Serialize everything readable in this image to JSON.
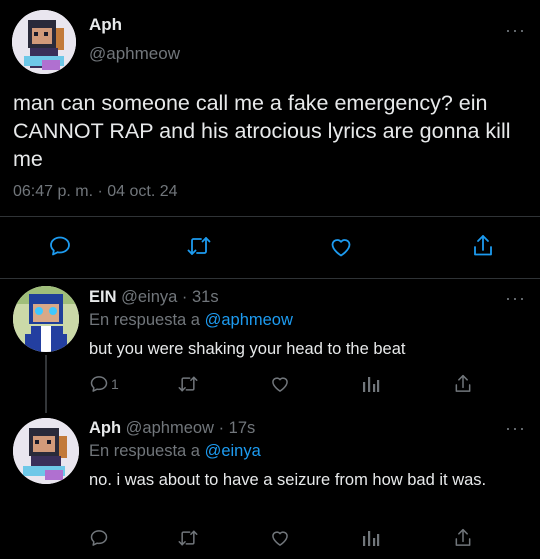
{
  "main_tweet": {
    "display_name": "Aph",
    "handle": "@aphmeow",
    "text": "man can someone call me a fake emergency? ein CANNOT RAP and his atrocious lyrics are gonna kill me",
    "timestamp": "06:47 p. m. · 04 oct. 24",
    "more": "···"
  },
  "reply1": {
    "display_name": "EIN",
    "handle": "@einya",
    "time": "· 31s",
    "reply_to_prefix": "En respuesta a",
    "reply_to_handle": "@aphmeow",
    "text": "but you were shaking your head to the beat",
    "reply_count": "1",
    "more": "···"
  },
  "reply2": {
    "display_name": "Aph",
    "handle": "@aphmeow",
    "time": "· 17s",
    "reply_to_prefix": "En respuesta a",
    "reply_to_handle": "@einya",
    "text": "no. i was about to have a seizure from how bad it was.",
    "more": "···"
  },
  "colors": {
    "background": "#000000",
    "text": "#e7e9ea",
    "muted": "#71767b",
    "link": "#1d9bf0",
    "action_main": "#1d9bf0",
    "divider": "#2f3336"
  },
  "icons": [
    "reply-icon",
    "retweet-icon",
    "like-icon",
    "share-icon",
    "views-icon",
    "more-icon"
  ]
}
